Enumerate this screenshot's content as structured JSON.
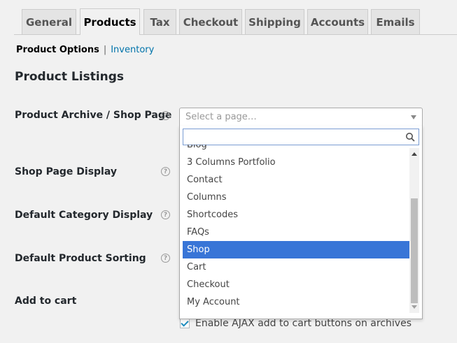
{
  "tabs": [
    "General",
    "Products",
    "Tax",
    "Checkout",
    "Shipping",
    "Accounts",
    "Emails"
  ],
  "active_tab": "Products",
  "subnav": {
    "current": "Product Options",
    "separator": "|",
    "link": "Inventory"
  },
  "section_title": "Product Listings",
  "rows": {
    "archive": "Product Archive / Shop Page",
    "display": "Shop Page Display",
    "category": "Default Category Display",
    "sorting": "Default Product Sorting",
    "cart": "Add to cart"
  },
  "help_glyph": "?",
  "select": {
    "placeholder": "Select a page…",
    "search_value": "",
    "options": [
      "Blog",
      "3 Columns Portfolio",
      "Contact",
      "Columns",
      "Shortcodes",
      "FAQs",
      "Shop",
      "Cart",
      "Checkout",
      "My Account"
    ],
    "highlighted": "Shop"
  },
  "checkbox_label": "Enable AJAX add to cart buttons on archives",
  "colors": {
    "accent": "#3875d7",
    "link": "#0073aa"
  }
}
